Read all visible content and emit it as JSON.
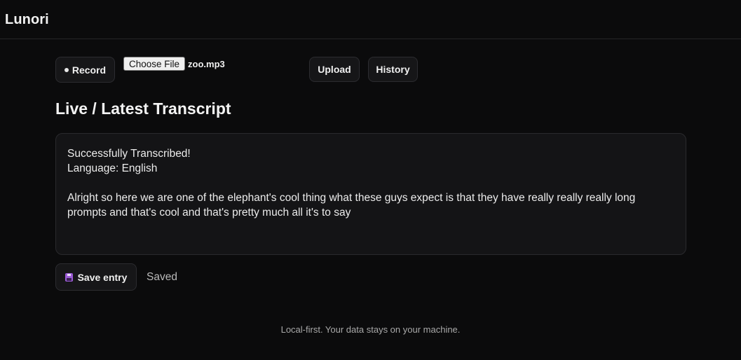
{
  "app": {
    "title": "Lunori"
  },
  "toolbar": {
    "record_label": "Record",
    "choose_file_label": "Choose File",
    "file_name": "zoo.mp3",
    "upload_label": "Upload",
    "history_label": "History"
  },
  "transcript": {
    "heading": "Live / Latest Transcript",
    "status": "Successfully Transcribed!",
    "language": "Language: English",
    "body": "Alright so here we are one of the elephant's cool thing what these guys expect is that they have really really really long prompts and that's cool and that's pretty much all it's to say"
  },
  "actions": {
    "save_label": "Save entry",
    "save_icon": "floppy-disk-icon",
    "save_status": "Saved"
  },
  "footer": {
    "text": "Local-first. Your data stays on your machine."
  },
  "colors": {
    "background": "#0b0b0c",
    "panel": "#141416",
    "button": "#161618",
    "accent_icon": "#9b5bd6"
  }
}
